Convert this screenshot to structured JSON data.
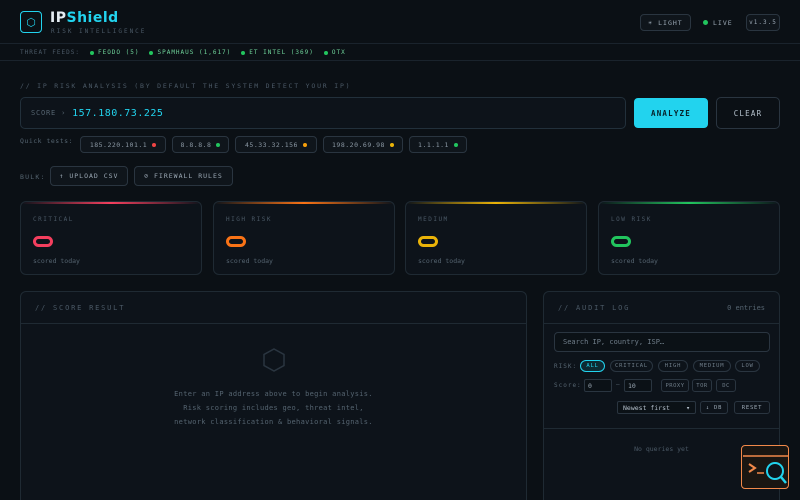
{
  "header": {
    "brand_a": "IP",
    "brand_b": "Shield",
    "tagline": "RISK INTELLIGENCE",
    "logo_glyph": "⬡",
    "theme_label": "☀ LIGHT",
    "live_label": "LIVE",
    "version": "v1.3.5"
  },
  "feeds": {
    "label": "THREAT FEEDS:",
    "items": [
      {
        "label": "FEODO (5)"
      },
      {
        "label": "SPAMHAUS (1,617)"
      },
      {
        "label": "ET INTEL (369)"
      },
      {
        "label": "OTX"
      }
    ]
  },
  "analysis": {
    "section_title": "// IP RISK ANALYSIS (BY DEFAULT THE SYSTEM DETECT YOUR IP)",
    "input_prefix": "SCORE ›",
    "input_value": "157.180.73.225",
    "analyze_label": "ANALYZE",
    "clear_label": "CLEAR",
    "quick_tests_label": "Quick tests:",
    "quick_tests": [
      {
        "ip": "185.220.101.1",
        "color": "#ef4444"
      },
      {
        "ip": "8.8.8.8",
        "color": "#22c55e"
      },
      {
        "ip": "45.33.32.156",
        "color": "#f59e0b"
      },
      {
        "ip": "198.20.69.98",
        "color": "#eab308"
      },
      {
        "ip": "1.1.1.1",
        "color": "#22c55e"
      }
    ],
    "bulk_label": "BULK:",
    "upload_label": "↑ UPLOAD CSV",
    "firewall_label": "⊘ FIREWALL RULES"
  },
  "risk_cards": [
    {
      "title": "CRITICAL",
      "sub": "scored today",
      "color": "#f43f5e"
    },
    {
      "title": "HIGH RISK",
      "sub": "scored today",
      "color": "#f97316"
    },
    {
      "title": "MEDIUM",
      "sub": "scored today",
      "color": "#eab308"
    },
    {
      "title": "LOW RISK",
      "sub": "scored today",
      "color": "#22c55e"
    }
  ],
  "score_panel": {
    "title": "// SCORE RESULT",
    "message_lines": [
      "Enter an IP address above to begin analysis.",
      "Risk scoring includes geo, threat intel,",
      "network classification & behavioral signals."
    ]
  },
  "audit": {
    "title": "// AUDIT LOG",
    "entries": "0 entries",
    "search_placeholder": "Search IP, country, ISP…",
    "risk_label": "RISK:",
    "risk_filters": [
      "ALL",
      "CRITICAL",
      "HIGH",
      "MEDIUM",
      "LOW"
    ],
    "score_label": "Score:",
    "score_min": "0",
    "score_dash": "–",
    "score_max": "10",
    "tags": [
      "PROXY",
      "TOR",
      "DC"
    ],
    "sort_value": "Newest first",
    "db_label": "↓ DB",
    "reset_label": "RESET",
    "empty": "No queries yet"
  },
  "colors": {
    "accent": "#22d3ee",
    "live": "#22c55e"
  }
}
